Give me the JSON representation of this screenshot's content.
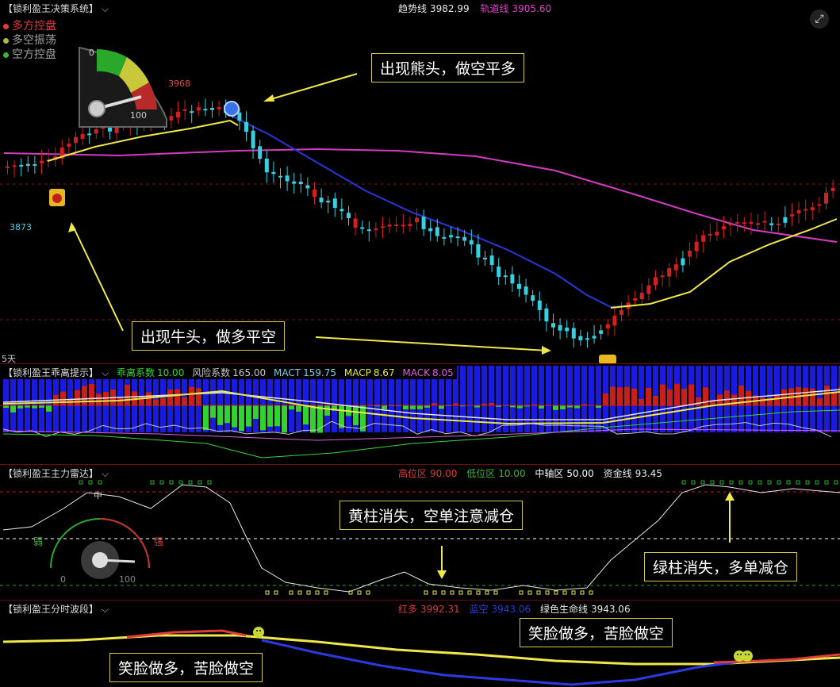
{
  "main": {
    "title": "【锁利盈王决策系统】",
    "trend": {
      "label": "趋势线",
      "value": "3982.99"
    },
    "rail": {
      "label": "轨道线",
      "value": "3905.60"
    },
    "legend": [
      {
        "label": "多方控盘",
        "color": "#e03c3c"
      },
      {
        "label": "多空振荡",
        "color": "#b5b53c"
      },
      {
        "label": "空方控盘",
        "color": "#3cb43c"
      }
    ],
    "gauge_min": "0",
    "gauge_max": "100",
    "price_high": "3968",
    "price_low": "3873",
    "period": "5天",
    "callout_bear": "出现熊头，做空平多",
    "callout_bull": "出现牛头，做多平空"
  },
  "panel2": {
    "title": "【锁利盈王乖离提示】",
    "items": [
      {
        "label": "乖离系数",
        "value": "10.00",
        "color": "#3ad53a"
      },
      {
        "label": "风险系数",
        "value": "165.00",
        "color": "#c8c8c8"
      },
      {
        "label": "MACT",
        "value": "159.75",
        "color": "#7ad0e8"
      },
      {
        "label": "MACP",
        "value": "8.67",
        "color": "#e8e84a"
      },
      {
        "label": "MACK",
        "value": "8.05",
        "color": "#e060e0"
      }
    ]
  },
  "panel3": {
    "title": "【锁利盈王主力雷达】",
    "items": [
      {
        "label": "高位区",
        "value": "90.00",
        "color": "#e03c3c"
      },
      {
        "label": "低位区",
        "value": "10.00",
        "color": "#3cb43c"
      },
      {
        "label": "中轴区",
        "value": "50.00",
        "color": "#ffffff"
      },
      {
        "label": "资金线",
        "value": "93.45",
        "color": "#e8e8e8"
      }
    ],
    "gauge_mid": "中",
    "gauge_weak": "弱",
    "gauge_strong": "强",
    "gauge_min": "0",
    "gauge_max": "100",
    "callout_yellow": "黄柱消失，空单注意减仓",
    "callout_green": "绿柱消失，多单减仓"
  },
  "panel4": {
    "title": "【锁利盈王分时波段】",
    "items": [
      {
        "label": "红多",
        "value": "3992.31",
        "color": "#e03c3c"
      },
      {
        "label": "蓝空",
        "value": "3943.06",
        "color": "#2a3ae0"
      },
      {
        "label": "绿色生命线",
        "value": "3943.06",
        "color": "#e8e8e8"
      }
    ],
    "callout_a": "笑脸做多，苦脸做空",
    "callout_b": "笑脸做多，苦脸做空"
  },
  "icons": {
    "chevron": "chevron-down-icon",
    "expand": "expand-icon",
    "bull": "bull-head-icon",
    "bear": "bear-head-icon",
    "smile": "smiley-icon"
  }
}
